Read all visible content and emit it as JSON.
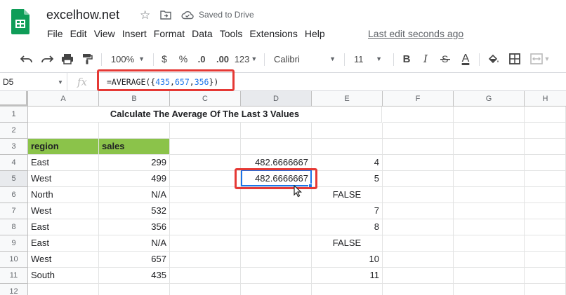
{
  "app": {
    "doc_title": "excelhow.net",
    "saved_status": "Saved to Drive",
    "last_edit": "Last edit seconds ago"
  },
  "menu": [
    "File",
    "Edit",
    "View",
    "Insert",
    "Format",
    "Data",
    "Tools",
    "Extensions",
    "Help"
  ],
  "toolbar": {
    "zoom": "100%",
    "currency": "$",
    "percent": "%",
    "dec_decrease": ".0",
    "dec_increase": ".00",
    "more_formats": "123",
    "font": "Calibri",
    "font_size": "11",
    "bold": "B",
    "italic": "I",
    "text_color": "A"
  },
  "formula_bar": {
    "name_box": "D5",
    "fx": "fx",
    "formula_prefix": "=AVERAGE({",
    "formula_nums": [
      "435",
      "657",
      "356"
    ],
    "formula_suffix": "})"
  },
  "columns": [
    "A",
    "B",
    "C",
    "D",
    "E",
    "F",
    "G",
    "H"
  ],
  "rows": [
    "1",
    "2",
    "3",
    "4",
    "5",
    "6",
    "7",
    "8",
    "9",
    "10",
    "11",
    "12"
  ],
  "sheet": {
    "title": "Calculate The Average Of The Last 3 Values",
    "header_region": "region",
    "header_sales": "sales",
    "data": [
      {
        "region": "East",
        "sales": "299",
        "d": "482.6666667",
        "e": "4"
      },
      {
        "region": "West",
        "sales": "499",
        "d": "482.6666667",
        "e": "5"
      },
      {
        "region": "North",
        "sales": "N/A",
        "d": "",
        "e": "FALSE"
      },
      {
        "region": "West",
        "sales": "532",
        "d": "",
        "e": "7"
      },
      {
        "region": "East",
        "sales": "356",
        "d": "",
        "e": "8"
      },
      {
        "region": "East",
        "sales": "N/A",
        "d": "",
        "e": "FALSE"
      },
      {
        "region": "West",
        "sales": "657",
        "d": "",
        "e": "10"
      },
      {
        "region": "South",
        "sales": "435",
        "d": "",
        "e": "11"
      }
    ]
  },
  "colors": {
    "header_green": "#8bc34a",
    "highlight_red": "#e53935",
    "selection_blue": "#1a73e8"
  }
}
